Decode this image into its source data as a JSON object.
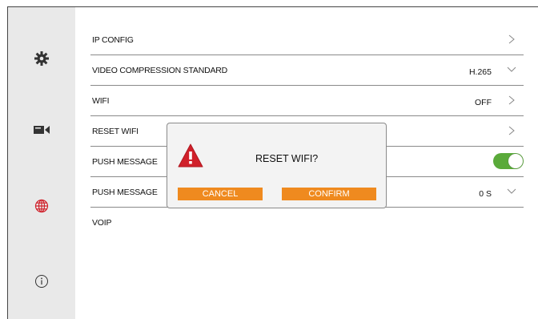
{
  "sidebar": {
    "items": [
      {
        "icon": "gear-icon"
      },
      {
        "icon": "video-camera-icon"
      },
      {
        "icon": "globe-icon"
      },
      {
        "icon": "info-icon"
      }
    ]
  },
  "settings": {
    "rows": [
      {
        "label": "IP CONFIG",
        "value": "",
        "control": "chevron-right"
      },
      {
        "label": "VIDEO COMPRESSION STANDARD",
        "value": "H.265",
        "control": "chevron-down"
      },
      {
        "label": "WIFI",
        "value": "OFF",
        "control": "chevron-right"
      },
      {
        "label": "RESET WIFI",
        "value": "",
        "control": "chevron-right"
      },
      {
        "label": "PUSH MESSAGE",
        "value": "",
        "control": "toggle",
        "toggle_on": true
      },
      {
        "label": "PUSH MESSAGE",
        "value": "0 S",
        "control": "chevron-down"
      },
      {
        "label": "VOIP",
        "value": "",
        "control": "none"
      }
    ]
  },
  "dialog": {
    "title": "RESET WIFI?",
    "icon": "warning-icon",
    "cancel_label": "CANCEL",
    "confirm_label": "CONFIRM"
  },
  "colors": {
    "sidebar_bg": "#e9e9e9",
    "accent_icon": "#d0202a",
    "button_orange": "#ef8a1f",
    "toggle_green": "#5aaa3a",
    "warning_red": "#d0202a"
  }
}
